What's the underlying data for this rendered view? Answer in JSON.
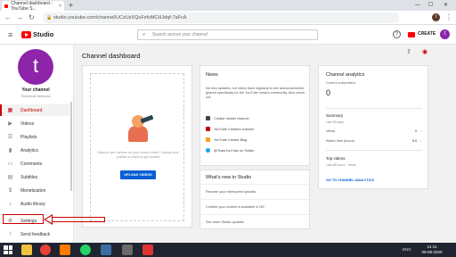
{
  "browser": {
    "tab_title": "Channel dashboard - YouTube S...",
    "tab_close": "×",
    "new_tab": "+",
    "url": "studio.youtube.com/channel/UCzUzXQuFxfvMCHJdqf-7aFcA",
    "minimize": "—",
    "maximize": "☐",
    "close": "✕",
    "profile_initial": "t",
    "back": "←",
    "forward": "→",
    "reload": "↻",
    "lock": "🔒",
    "menu": "⋮"
  },
  "header": {
    "menu": "≡",
    "logo_text": "Studio",
    "search_placeholder": "Search across your channel",
    "search_icon": "⌕",
    "help": "?",
    "create_label": "CREATE",
    "avatar_initial": "t"
  },
  "sidebar": {
    "avatar_initial": "t",
    "channel_title": "Your channel",
    "channel_sub": "Technical Meeruss",
    "items": [
      {
        "label": "Dashboard",
        "icon": "▦",
        "active": true
      },
      {
        "label": "Videos",
        "icon": "▶"
      },
      {
        "label": "Playlists",
        "icon": "☰"
      },
      {
        "label": "Analytics",
        "icon": "▮"
      },
      {
        "label": "Comments",
        "icon": "▭"
      },
      {
        "label": "Subtitles",
        "icon": "▤"
      },
      {
        "label": "Monetization",
        "icon": "$"
      },
      {
        "label": "Audio library",
        "icon": "♪"
      },
      {
        "label": "Settings",
        "icon": "⚙"
      },
      {
        "label": "Send feedback",
        "icon": "!"
      }
    ]
  },
  "main": {
    "title": "Channel dashboard",
    "upload_icon": "⇪",
    "live_icon": "◉",
    "upload": {
      "text": "Want to see metrics on your recent video? Upload and publish a video to get started",
      "button": "UPLOAD VIDEOS"
    },
    "news": {
      "title": "News",
      "text": "No new updates, but check back regularly to see announcements geared specifically for the YouTube creator community. Also check out:",
      "items": [
        {
          "label": "Creator Insider channel",
          "color": "#444444"
        },
        {
          "label": "YouTube Creators channel",
          "color": "#cc0000"
        },
        {
          "label": "YouTube Creator Blog",
          "color": "#f4a020"
        },
        {
          "label": "@TeamYouTube on Twitter",
          "color": "#1da1f2"
        }
      ]
    },
    "whats_new": {
      "title": "What's new in Studio",
      "items": [
        "Resume your interrupted uploads",
        "Confirm your content is available in HD",
        "See more Studio updates"
      ]
    },
    "analytics": {
      "title": "Channel analytics",
      "subs_label": "Current subscribers",
      "subs_value": "0",
      "summary_title": "Summary",
      "summary_period": "Last 28 days",
      "views_label": "Views",
      "views_value": "0",
      "views_delta": "—",
      "watch_label": "Watch time (hours)",
      "watch_value": "0.0",
      "watch_delta": "—",
      "top_title": "Top videos",
      "top_period": "Last 48 hours · Views",
      "link": "GO TO CHANNEL ANALYTICS"
    }
  },
  "taskbar": {
    "tray_lang": "ENG",
    "time": "21:11",
    "date": "09-08-2020"
  },
  "colors": {
    "accent_red": "#cc0000",
    "link_blue": "#065fd4",
    "purple_avatar": "#8e24aa"
  }
}
